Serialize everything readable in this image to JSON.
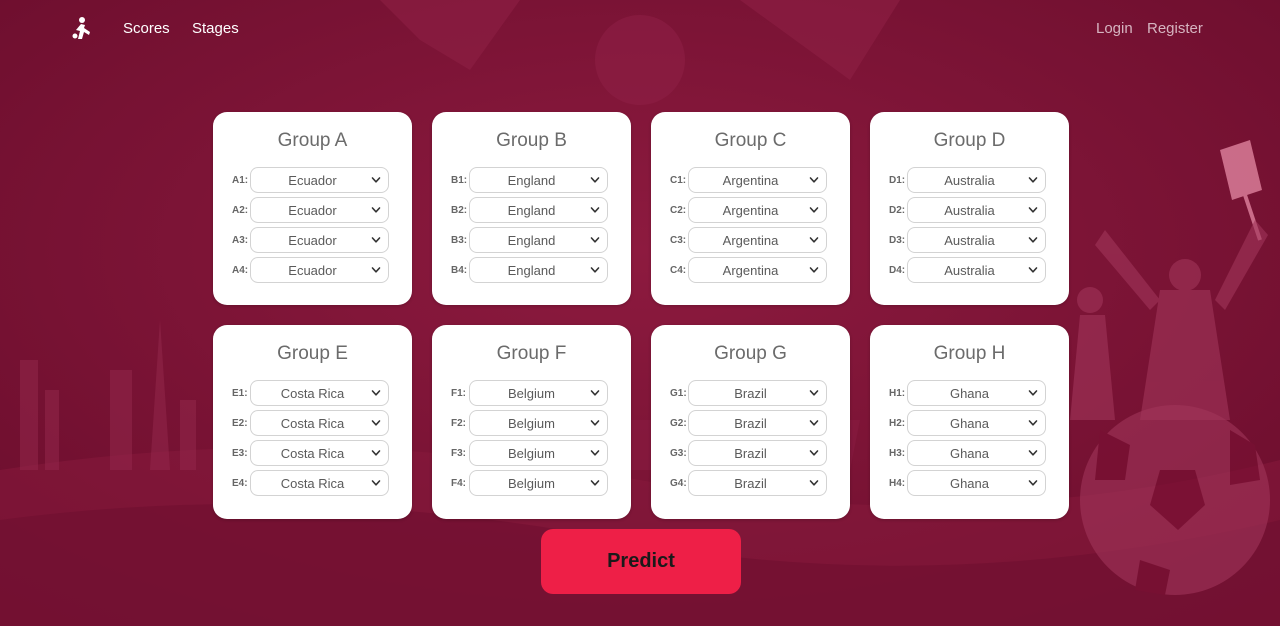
{
  "colors": {
    "background": "#7a1033",
    "card": "#ffffff",
    "predict_button": "#ee1f47",
    "nav_text": "#ffffff"
  },
  "nav": {
    "logo_icon": "player-logo-icon",
    "links": [
      "Scores",
      "Stages"
    ],
    "login": "Login",
    "register": "Register"
  },
  "groups": [
    {
      "title": "Group A",
      "slots": [
        {
          "label": "A1:",
          "value": "Ecuador"
        },
        {
          "label": "A2:",
          "value": "Ecuador"
        },
        {
          "label": "A3:",
          "value": "Ecuador"
        },
        {
          "label": "A4:",
          "value": "Ecuador"
        }
      ]
    },
    {
      "title": "Group B",
      "slots": [
        {
          "label": "B1:",
          "value": "England"
        },
        {
          "label": "B2:",
          "value": "England"
        },
        {
          "label": "B3:",
          "value": "England"
        },
        {
          "label": "B4:",
          "value": "England"
        }
      ]
    },
    {
      "title": "Group C",
      "slots": [
        {
          "label": "C1:",
          "value": "Argentina"
        },
        {
          "label": "C2:",
          "value": "Argentina"
        },
        {
          "label": "C3:",
          "value": "Argentina"
        },
        {
          "label": "C4:",
          "value": "Argentina"
        }
      ]
    },
    {
      "title": "Group D",
      "slots": [
        {
          "label": "D1:",
          "value": "Australia"
        },
        {
          "label": "D2:",
          "value": "Australia"
        },
        {
          "label": "D3:",
          "value": "Australia"
        },
        {
          "label": "D4:",
          "value": "Australia"
        }
      ]
    },
    {
      "title": "Group E",
      "slots": [
        {
          "label": "E1:",
          "value": "Costa Rica"
        },
        {
          "label": "E2:",
          "value": "Costa Rica"
        },
        {
          "label": "E3:",
          "value": "Costa Rica"
        },
        {
          "label": "E4:",
          "value": "Costa Rica"
        }
      ]
    },
    {
      "title": "Group F",
      "slots": [
        {
          "label": "F1:",
          "value": "Belgium"
        },
        {
          "label": "F2:",
          "value": "Belgium"
        },
        {
          "label": "F3:",
          "value": "Belgium"
        },
        {
          "label": "F4:",
          "value": "Belgium"
        }
      ]
    },
    {
      "title": "Group G",
      "slots": [
        {
          "label": "G1:",
          "value": "Brazil"
        },
        {
          "label": "G2:",
          "value": "Brazil"
        },
        {
          "label": "G3:",
          "value": "Brazil"
        },
        {
          "label": "G4:",
          "value": "Brazil"
        }
      ]
    },
    {
      "title": "Group H",
      "slots": [
        {
          "label": "H1:",
          "value": "Ghana"
        },
        {
          "label": "H2:",
          "value": "Ghana"
        },
        {
          "label": "H3:",
          "value": "Ghana"
        },
        {
          "label": "H4:",
          "value": "Ghana"
        }
      ]
    }
  ],
  "predict_label": "Predict"
}
